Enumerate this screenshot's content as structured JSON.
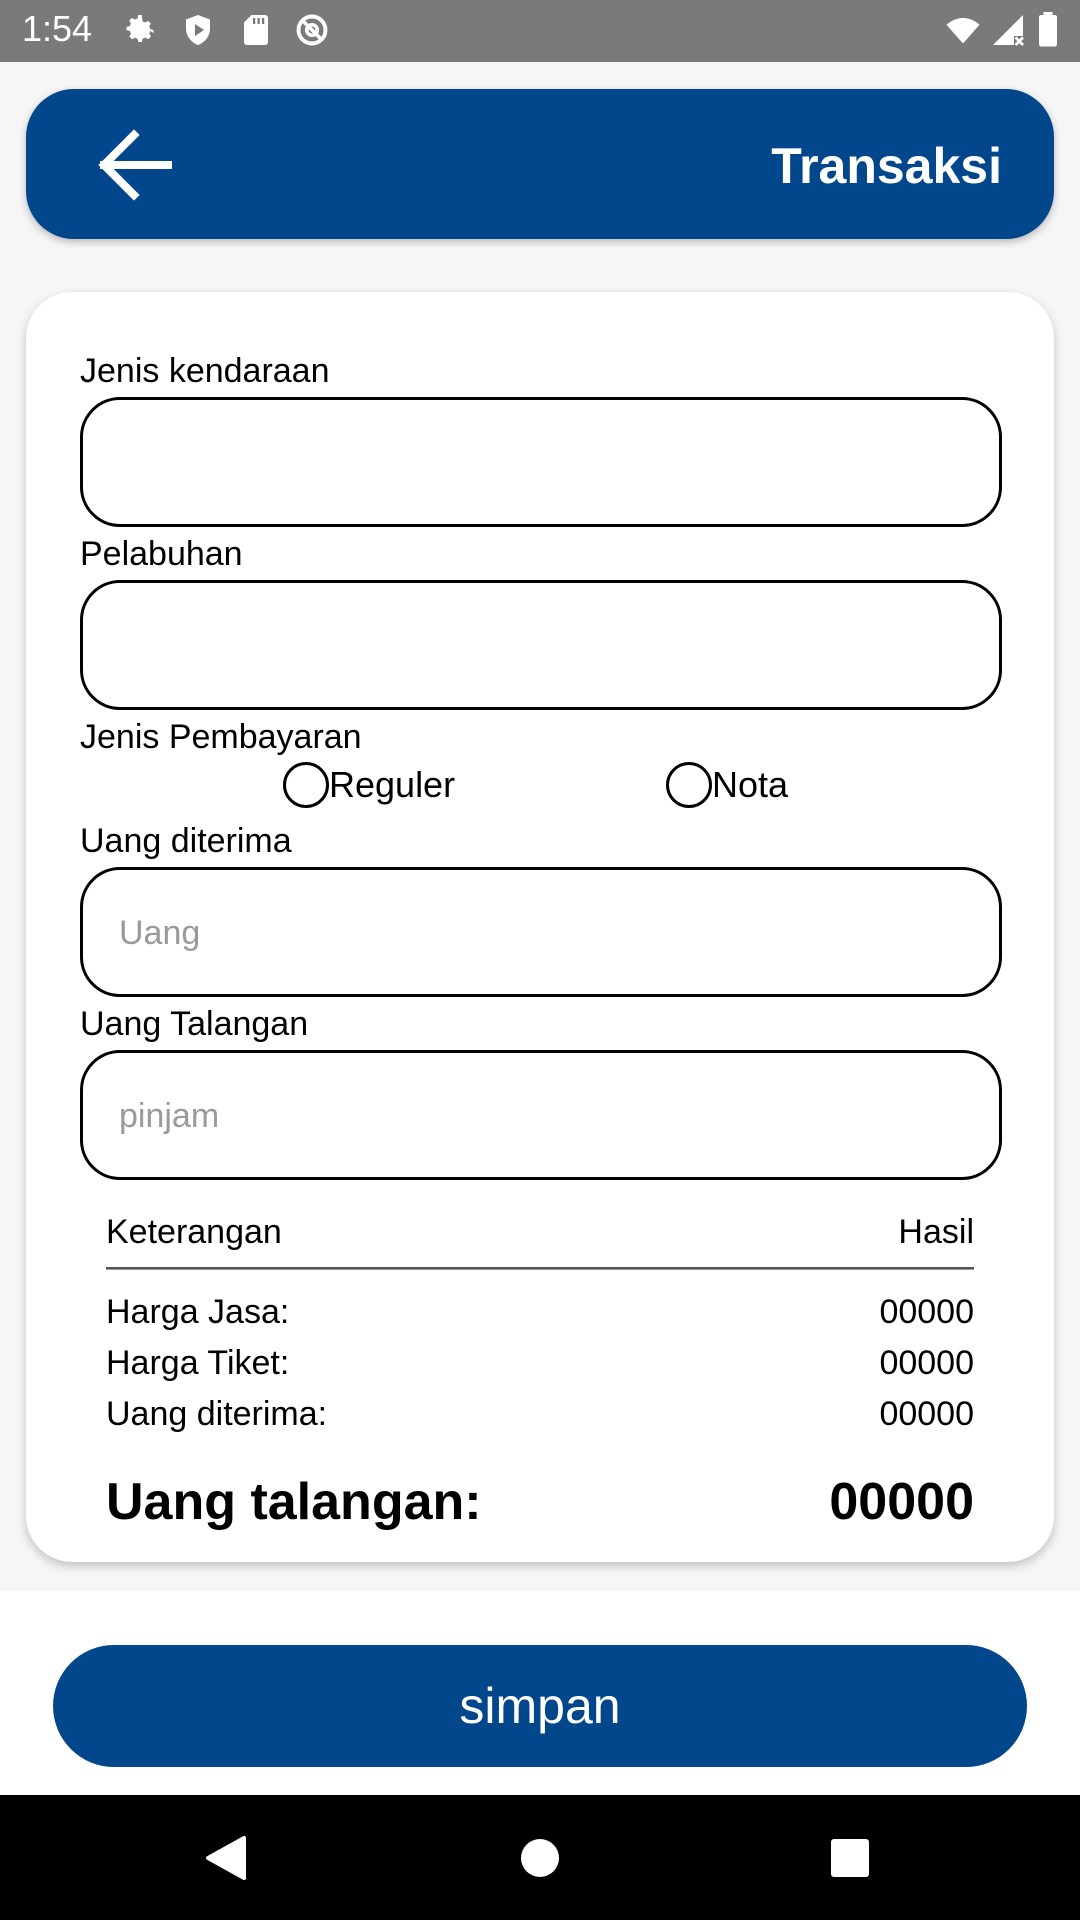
{
  "status_bar": {
    "time": "1:54",
    "left_icons": [
      "gear-icon",
      "shield-icon",
      "sd-card-icon",
      "at-sign-icon"
    ],
    "right_icons": [
      "wifi-icon",
      "signal-icon",
      "battery-icon"
    ]
  },
  "header": {
    "title": "Transaksi",
    "back_icon": "arrow-left-icon",
    "color": "#02468b"
  },
  "form": {
    "vehicle_type": {
      "label": "Jenis kendaraan",
      "value": "",
      "placeholder": ""
    },
    "port": {
      "label": "Pelabuhan",
      "value": "",
      "placeholder": ""
    },
    "payment_type": {
      "label": "Jenis Pembayaran",
      "options": [
        "Reguler",
        "Nota"
      ]
    },
    "money_received": {
      "label": "Uang diterima",
      "value": "",
      "placeholder": "Uang"
    },
    "bailout_money": {
      "label": "Uang Talangan",
      "value": "",
      "placeholder": "pinjam"
    }
  },
  "summary": {
    "header_left": "Keterangan",
    "header_right": "Hasil",
    "rows": [
      {
        "label": "Harga Jasa:",
        "value": "00000"
      },
      {
        "label": "Harga Tiket:",
        "value": "00000"
      },
      {
        "label": "Uang diterima:",
        "value": "00000"
      }
    ],
    "total": {
      "label": "Uang talangan:",
      "value": "00000"
    }
  },
  "save_button": {
    "label": "simpan"
  },
  "nav_bar": {
    "icons": [
      "back-triangle-icon",
      "home-circle-icon",
      "recents-square-icon"
    ]
  }
}
